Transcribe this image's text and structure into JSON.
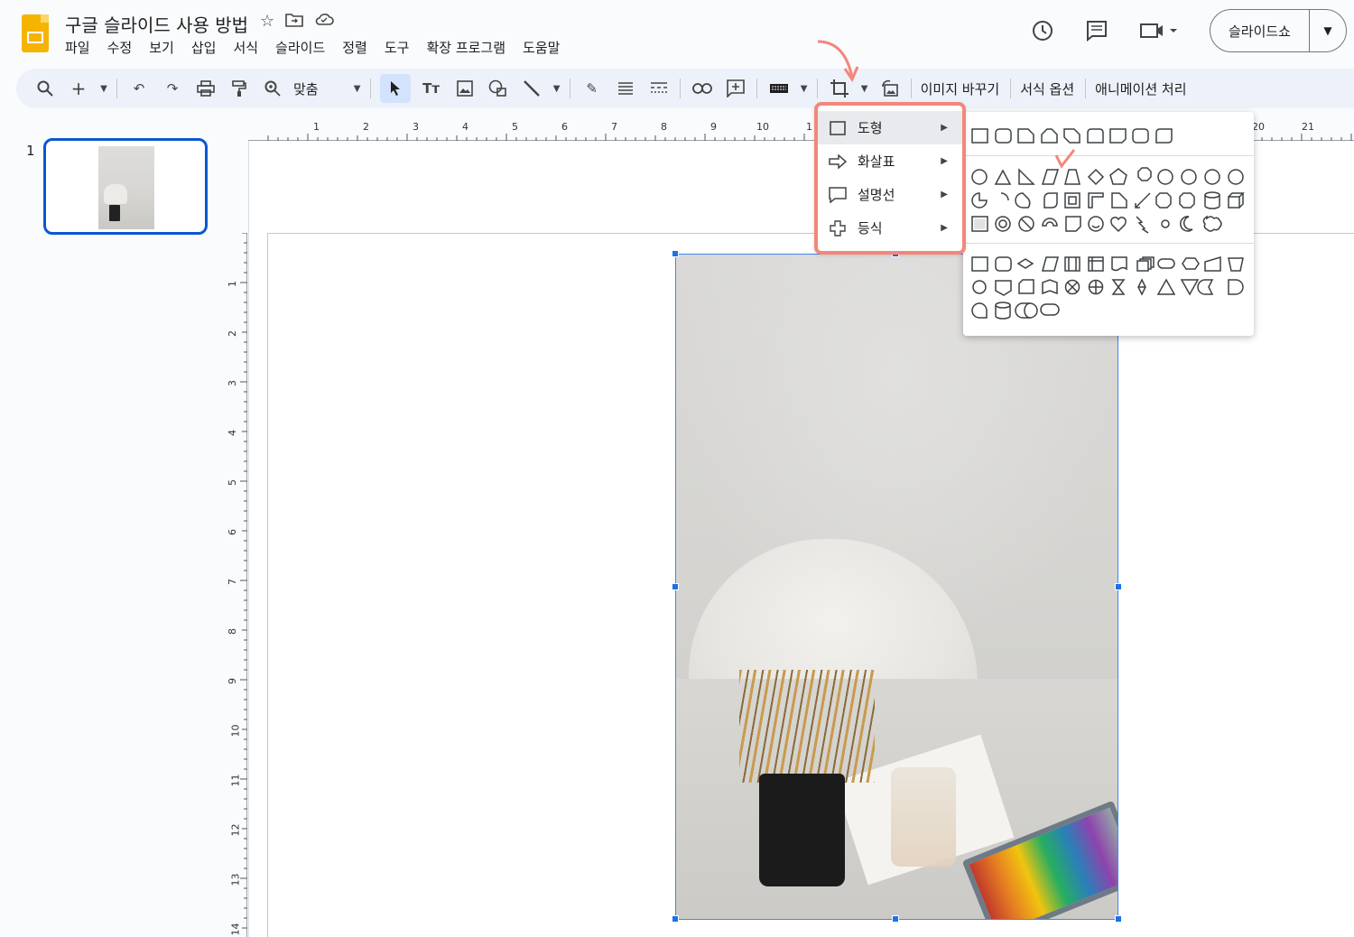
{
  "header": {
    "title": "구글 슬라이드 사용 방법",
    "menus": [
      "파일",
      "수정",
      "보기",
      "삽입",
      "서식",
      "슬라이드",
      "정렬",
      "도구",
      "확장 프로그램",
      "도움말"
    ],
    "slideshow_label": "슬라이드쇼"
  },
  "toolbar": {
    "zoom_value": "맞춤",
    "replace_image": "이미지 바꾸기",
    "format_options": "서식 옵션",
    "animation": "애니메이션 처리"
  },
  "filmstrip": {
    "slide_number": "1"
  },
  "rulers": {
    "horizontal": [
      "1",
      "2",
      "3",
      "4",
      "5",
      "6",
      "7",
      "8",
      "9",
      "10",
      "1",
      "20",
      "21"
    ],
    "vertical": [
      "1",
      "2",
      "3",
      "4",
      "5",
      "6",
      "7",
      "8",
      "9",
      "10",
      "11",
      "12",
      "13",
      "14"
    ]
  },
  "menu": {
    "items": [
      {
        "label": "도형",
        "icon": "square-icon"
      },
      {
        "label": "화살표",
        "icon": "arrow-icon"
      },
      {
        "label": "설명선",
        "icon": "callout-icon"
      },
      {
        "label": "등식",
        "icon": "plus-icon"
      }
    ]
  },
  "colors": {
    "accent": "#0b57d0",
    "annotation": "#f2877a",
    "toolbar_bg": "#edf2fa",
    "logo": "#f5b400"
  }
}
